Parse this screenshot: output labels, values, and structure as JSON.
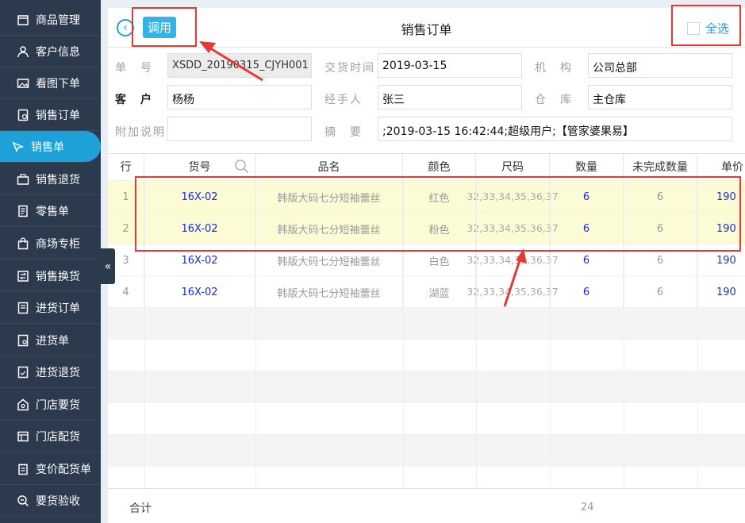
{
  "sidebar": {
    "items": [
      {
        "label": "商品管理",
        "icon": "box-icon"
      },
      {
        "label": "客户信息",
        "icon": "person-icon"
      },
      {
        "label": "看图下单",
        "icon": "image-icon"
      },
      {
        "label": "销售订单",
        "icon": "order-icon"
      },
      {
        "label": "销售单",
        "icon": "sale-icon",
        "active": true
      },
      {
        "label": "销售退货",
        "icon": "return-icon"
      },
      {
        "label": "零售单",
        "icon": "receipt-icon"
      },
      {
        "label": "商场专柜",
        "icon": "bag-icon"
      },
      {
        "label": "销售换货",
        "icon": "exchange-icon"
      },
      {
        "label": "进货订单",
        "icon": "purchase-order-icon"
      },
      {
        "label": "进货单",
        "icon": "purchase-icon"
      },
      {
        "label": "进货退货",
        "icon": "purchase-return-icon"
      },
      {
        "label": "门店要货",
        "icon": "store-request-icon"
      },
      {
        "label": "门店配货",
        "icon": "store-distribute-icon"
      },
      {
        "label": "变价配货单",
        "icon": "price-change-icon"
      },
      {
        "label": "要货验收",
        "icon": "inspect-icon"
      }
    ]
  },
  "header": {
    "call_label": "调用",
    "title": "销售订单",
    "select_all_label": "全选"
  },
  "form": {
    "order_no_label": "单　号",
    "order_no_value": "XSDD_20190315_CJYH001",
    "delivery_time_label": "交货时间",
    "delivery_time_value": "2019-03-15",
    "org_label": "机　构",
    "org_value": "公司总部",
    "customer_label": "客　户",
    "customer_value": "杨杨",
    "handler_label": "经手人",
    "handler_value": "张三",
    "warehouse_label": "仓　库",
    "warehouse_value": "主仓库",
    "note_label": "附加说明",
    "note_value": "",
    "summary_label": "摘　要",
    "summary_value": ";2019-03-15 16:42:44;超级用户;【管家婆果易】"
  },
  "grid": {
    "headers": {
      "row": "行",
      "code": "货号",
      "name": "品名",
      "color": "颜色",
      "size": "尺码",
      "qty": "数量",
      "undone": "未完成数量",
      "price": "单价"
    },
    "rows": [
      {
        "idx": "1",
        "code": "16X-02",
        "name": "韩版大码七分短袖蕾丝",
        "color": "红色",
        "size": "32,33,34,35,36,37",
        "qty": "6",
        "undone": "6",
        "price": "190"
      },
      {
        "idx": "2",
        "code": "16X-02",
        "name": "韩版大码七分短袖蕾丝",
        "color": "粉色",
        "size": "32,33,34,35,36,37",
        "qty": "6",
        "undone": "6",
        "price": "190"
      },
      {
        "idx": "3",
        "code": "16X-02",
        "name": "韩版大码七分短袖蕾丝",
        "color": "白色",
        "size": "32,33,34,35,36,37",
        "qty": "6",
        "undone": "6",
        "price": "190"
      },
      {
        "idx": "4",
        "code": "16X-02",
        "name": "韩版大码七分短袖蕾丝",
        "color": "湖蓝",
        "size": "32,33,34,35,36,37",
        "qty": "6",
        "undone": "6",
        "price": "190"
      }
    ]
  },
  "footer": {
    "total_label": "合计",
    "total_qty": "24"
  },
  "colors": {
    "sidebar_bg": "#2b3a4d",
    "accent": "#1ea0d8",
    "highlight_row": "#fbfbd6",
    "annotation_red": "#e53935"
  }
}
